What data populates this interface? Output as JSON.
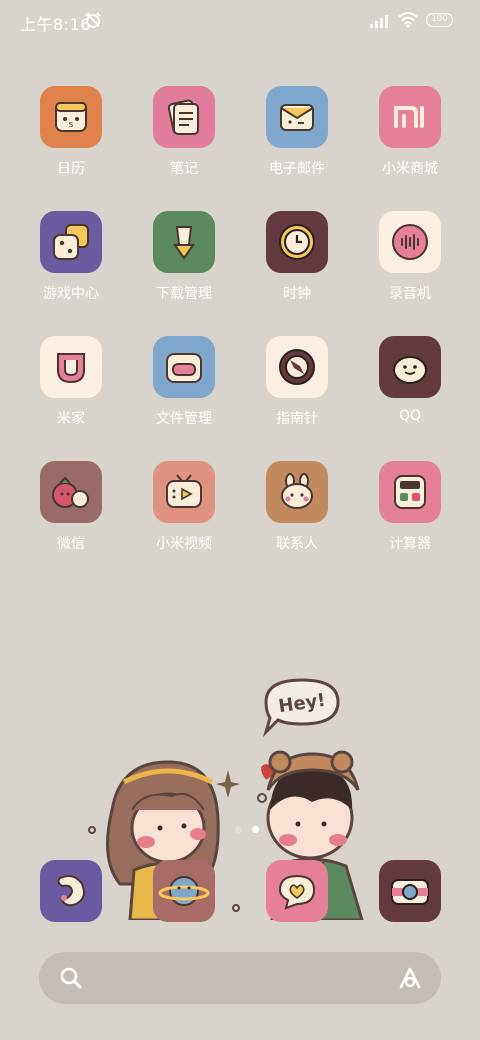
{
  "status_bar": {
    "time": "上午8:16",
    "battery": "100"
  },
  "apps": [
    {
      "label": "日历",
      "icon": "calendar-icon",
      "color": "#e0824c"
    },
    {
      "label": "笔记",
      "icon": "notes-icon",
      "color": "#e17c9c"
    },
    {
      "label": "电子邮件",
      "icon": "email-icon",
      "color": "#7fa6cc"
    },
    {
      "label": "小米商城",
      "icon": "mi-store-icon",
      "color": "#e57f9a"
    },
    {
      "label": "游戏中心",
      "icon": "game-center-icon",
      "color": "#6a5aa0"
    },
    {
      "label": "下载管理",
      "icon": "download-manager-icon",
      "color": "#5b8a5e"
    },
    {
      "label": "时钟",
      "icon": "clock-icon",
      "color": "#643a40"
    },
    {
      "label": "录音机",
      "icon": "recorder-icon",
      "color": "#fbefe4"
    },
    {
      "label": "米家",
      "icon": "mijia-icon",
      "color": "#fbefe4"
    },
    {
      "label": "文件管理",
      "icon": "file-manager-icon",
      "color": "#7fa6cc"
    },
    {
      "label": "指南针",
      "icon": "compass-icon",
      "color": "#fbefe4"
    },
    {
      "label": "QQ",
      "icon": "qq-icon",
      "color": "#643a40"
    },
    {
      "label": "微信",
      "icon": "wechat-icon",
      "color": "#9a6a68"
    },
    {
      "label": "小米视频",
      "icon": "mi-video-icon",
      "color": "#e1917f"
    },
    {
      "label": "联系人",
      "icon": "contacts-icon",
      "color": "#c08a5e"
    },
    {
      "label": "计算器",
      "icon": "calculator-icon",
      "color": "#e57f9a"
    }
  ],
  "dock": [
    {
      "icon": "phone-icon",
      "color": "#6a5aa0"
    },
    {
      "icon": "browser-planet-icon",
      "color": "#a86c68"
    },
    {
      "icon": "messages-icon",
      "color": "#e57f9a"
    },
    {
      "icon": "camera-icon",
      "color": "#643a40"
    }
  ],
  "illustration": {
    "speech_bubble": "Hey!"
  },
  "page_indicator": {
    "pages": 2,
    "current": 2
  }
}
